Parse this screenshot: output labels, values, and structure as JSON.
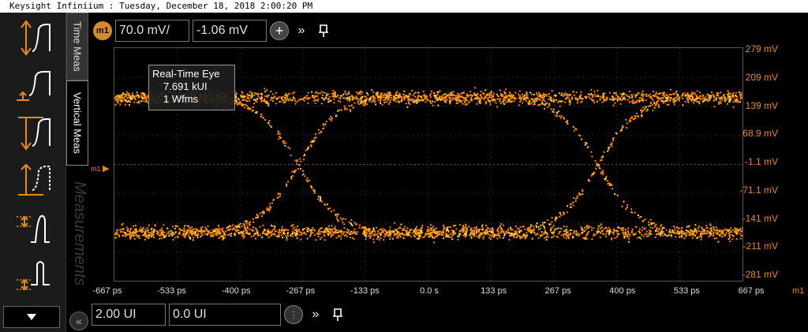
{
  "window": {
    "title": "Keysight Infiniium : Tuesday, December 18, 2018 2:00:20 PM"
  },
  "tabs": [
    {
      "label": "Time Meas",
      "active": false
    },
    {
      "label": "Vertical Meas",
      "active": true
    }
  ],
  "watermark": "Measurements",
  "left_panel": {
    "buttons": [
      "rise-time-icon",
      "fall-time-icon",
      "pulse-high-icon",
      "pulse-low-icon",
      "overshoot-icon",
      "preshoot-icon"
    ],
    "collapse_icon": "chevron-down-icon"
  },
  "vertical_toolbar": {
    "marker": "m1",
    "scale": "70.0 mV/",
    "offset": "-1.06 mV"
  },
  "horizontal_toolbar": {
    "scale": "2.00 UI",
    "position": "0.0 UI"
  },
  "eye_info": {
    "title": "Real-Time Eye",
    "count": "7.691 kUI",
    "waveforms": "1 Wfms"
  },
  "y_axis": {
    "labels": [
      "279 mV",
      "209 mV",
      "139 mV",
      "68.9 mV",
      "-1.1 mV",
      "-71.1 mV",
      "-141 mV",
      "-211 mV",
      "-281 mV"
    ]
  },
  "x_axis": {
    "labels": [
      "-667 ps",
      "-533 ps",
      "-400 ps",
      "-267 ps",
      "-133 ps",
      "0.0 s",
      "133 ps",
      "267 ps",
      "400 ps",
      "533 ps",
      "667 ps"
    ]
  },
  "marker_labels": {
    "left": "m1",
    "right": "m1"
  },
  "colors": {
    "trace": "#ff8a00",
    "trace_hot": "#ffd040",
    "axis_label": "#e88a1a",
    "grid": "#3a3a3a"
  }
}
